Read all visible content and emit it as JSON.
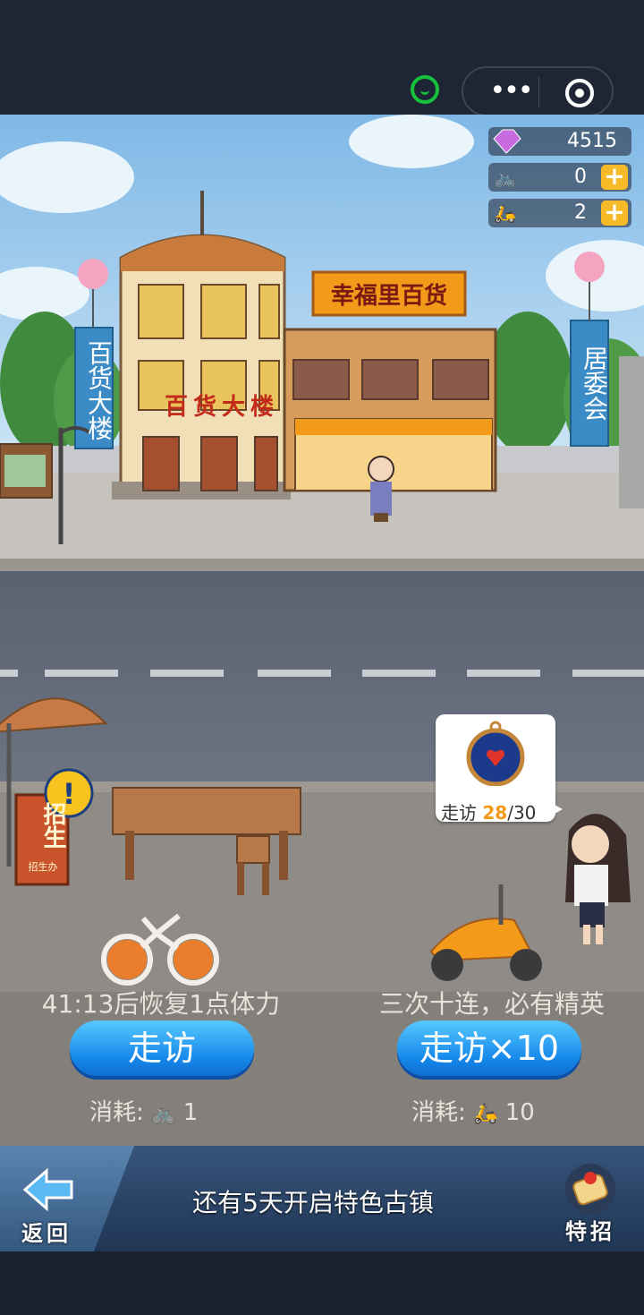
{
  "resources": {
    "gems": "4515",
    "bikes": "0",
    "scooters": "2"
  },
  "signs": {
    "banner_left": "百货大楼",
    "banner_right": "居委会",
    "store_sign": "幸福里百货",
    "building_sign": "百货大楼",
    "recruit_sign_main": "招生",
    "recruit_sign_small": "招生办"
  },
  "visit_bubble": {
    "label": "走访",
    "current": "28",
    "separator": "/",
    "total": "30"
  },
  "left_action": {
    "caption": "41:13后恢复1点体力",
    "button": "走访",
    "cost_label": "消耗:",
    "cost_value": "1"
  },
  "right_action": {
    "caption": "三次十连，必有精英",
    "button": "走访×10",
    "cost_label": "消耗:",
    "cost_value": "10"
  },
  "bottom_nav": {
    "back": "返回",
    "notice": "还有5天开启特色古镇",
    "special": "特招"
  },
  "colors": {
    "accent_orange": "#f39a1a",
    "button_blue": "#1587ea",
    "wechat_green": "#16c23c"
  }
}
